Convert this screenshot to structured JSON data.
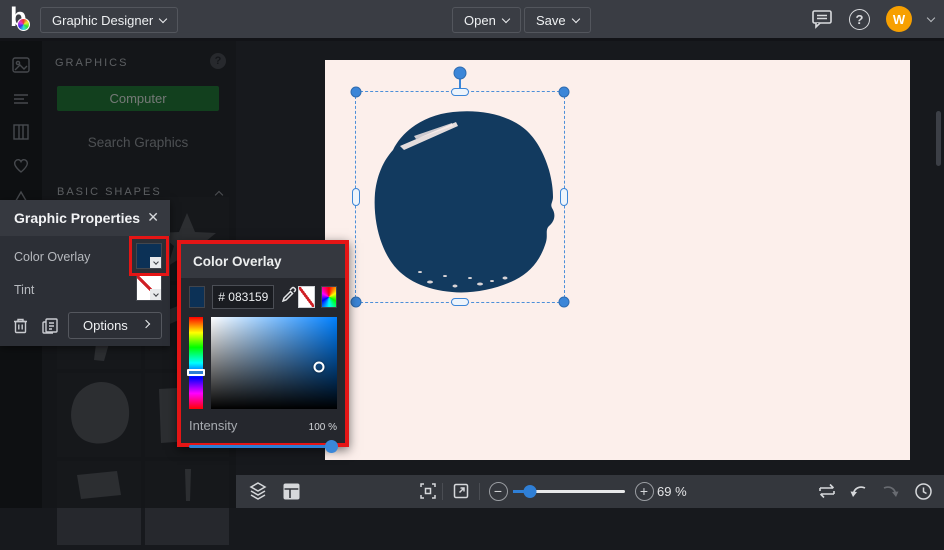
{
  "topbar": {
    "logo_letter": "b",
    "app_menu_label": "Graphic Designer",
    "open_label": "Open",
    "save_label": "Save",
    "help_glyph": "?",
    "avatar_initial": "W"
  },
  "sidebar": {
    "graphics_header": "GRAPHICS",
    "graphics_help_glyph": "?",
    "computer_button_label": "Computer",
    "search_placeholder": "Search Graphics",
    "basic_shapes_header": "BASIC SHAPES"
  },
  "props": {
    "title": "Graphic Properties",
    "close_glyph": "✕",
    "color_overlay_label": "Color Overlay",
    "tint_label": "Tint",
    "options_label": "Options"
  },
  "popup": {
    "title": "Color Overlay",
    "hex_value": "# 083159",
    "intensity_label": "Intensity",
    "intensity_value": "100 %"
  },
  "toolbar": {
    "zoom_value": "69 %"
  },
  "colors": {
    "overlay_color": "#083159",
    "canvas_background": "#FCEFEB",
    "shape_color": "#123A5F",
    "selection_accent": "#3C86D8",
    "annotation_red": "#E51515",
    "avatar_orange": "#F7A000",
    "computer_green": "#1E7C33"
  }
}
